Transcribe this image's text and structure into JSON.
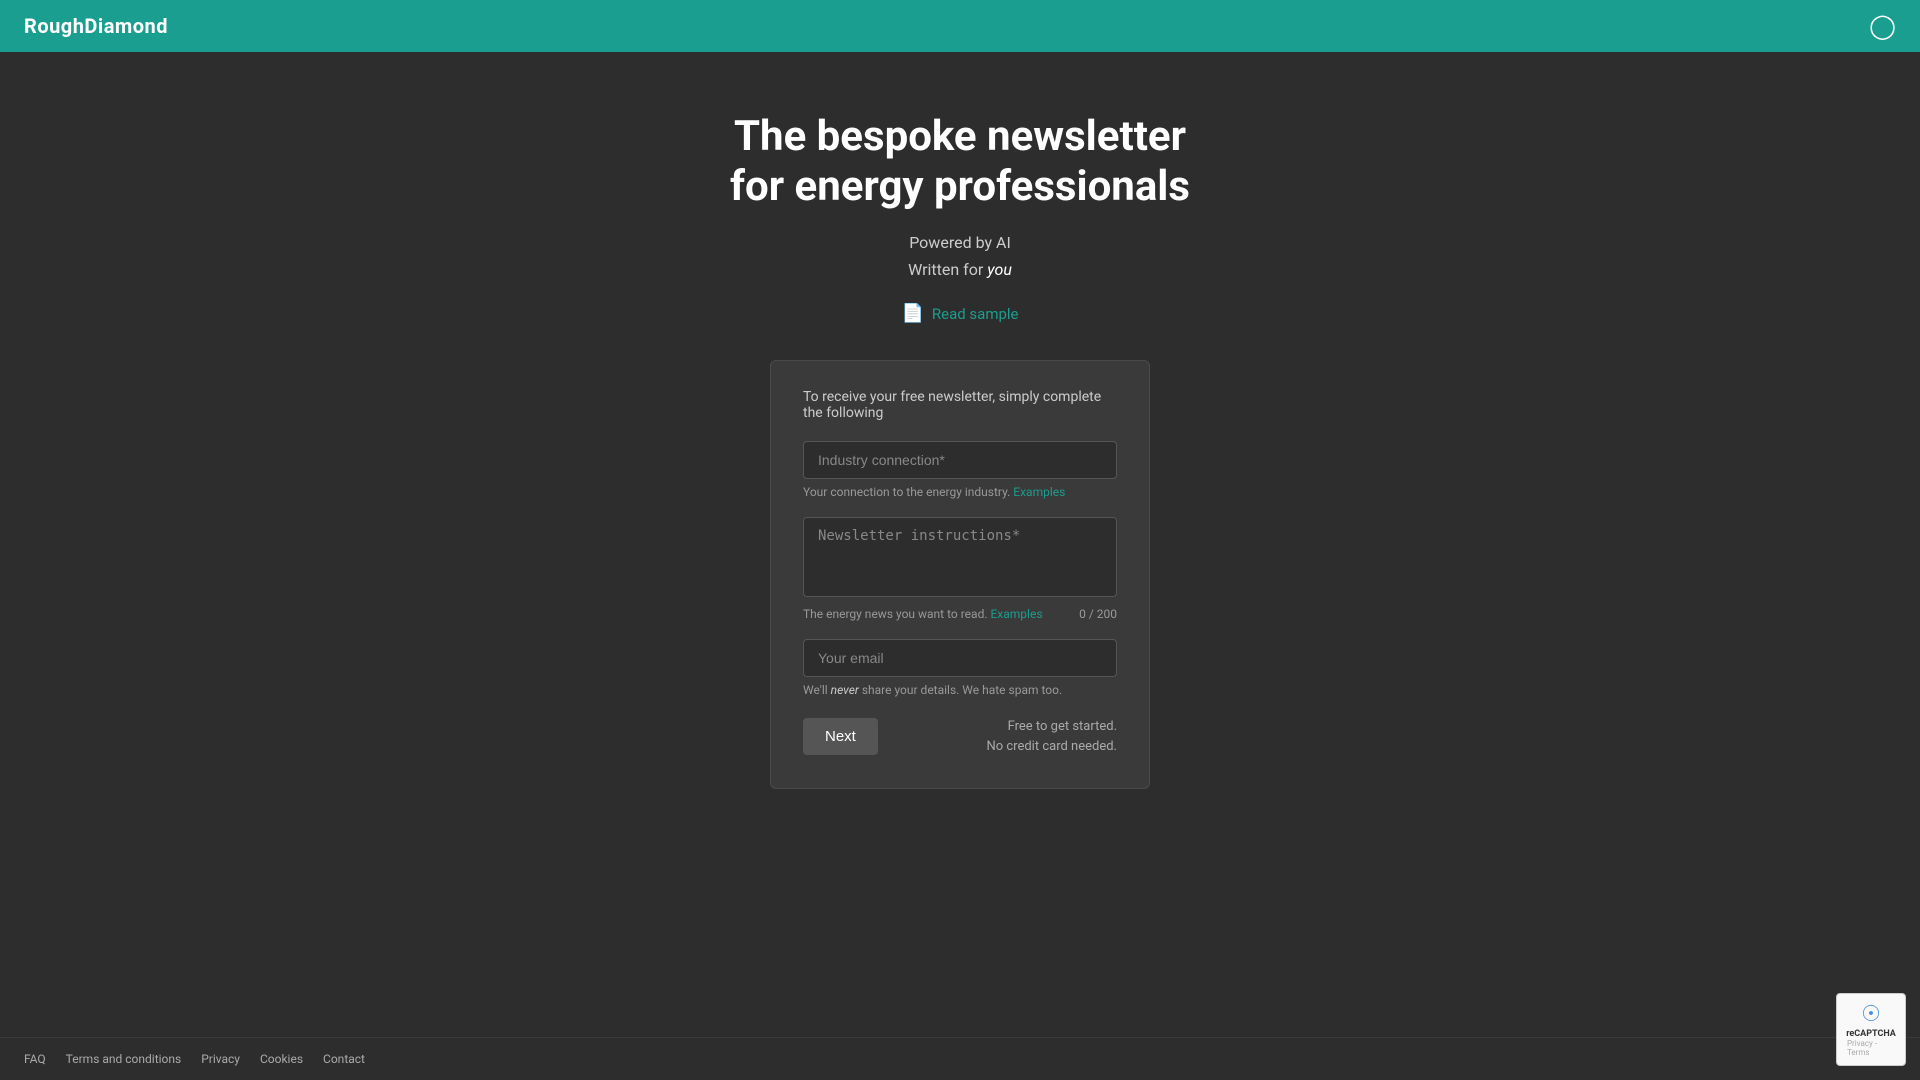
{
  "header": {
    "logo": "RoughDiamond",
    "account_icon": "👤"
  },
  "hero": {
    "title_line1": "The bespoke newsletter",
    "title_line2": "for energy professionals",
    "subtitle_line1": "Powered by AI",
    "subtitle_line2_prefix": "Written for ",
    "subtitle_line2_italic": "you",
    "read_sample_label": "Read sample"
  },
  "form": {
    "intro": "To receive your free newsletter, simply complete the following",
    "industry_connection": {
      "placeholder": "Industry connection*",
      "hint": "Your connection to the energy industry.",
      "hint_link": "Examples"
    },
    "newsletter_instructions": {
      "placeholder": "Newsletter instructions*",
      "hint": "The energy news you want to read.",
      "hint_link": "Examples",
      "char_count": "0 / 200"
    },
    "email": {
      "placeholder": "Your email",
      "spam_note_prefix": "We'll ",
      "spam_note_italic": "never",
      "spam_note_suffix": " share your details. We hate spam too."
    },
    "next_button": "Next",
    "free_note_line1": "Free to get started.",
    "free_note_line2": "No credit card needed."
  },
  "footer": {
    "links": [
      "FAQ",
      "Terms and conditions",
      "Privacy",
      "Cookies",
      "Contact"
    ]
  },
  "recaptcha": {
    "label": "reCAPTCHA",
    "subtext": "Privacy - Terms"
  }
}
